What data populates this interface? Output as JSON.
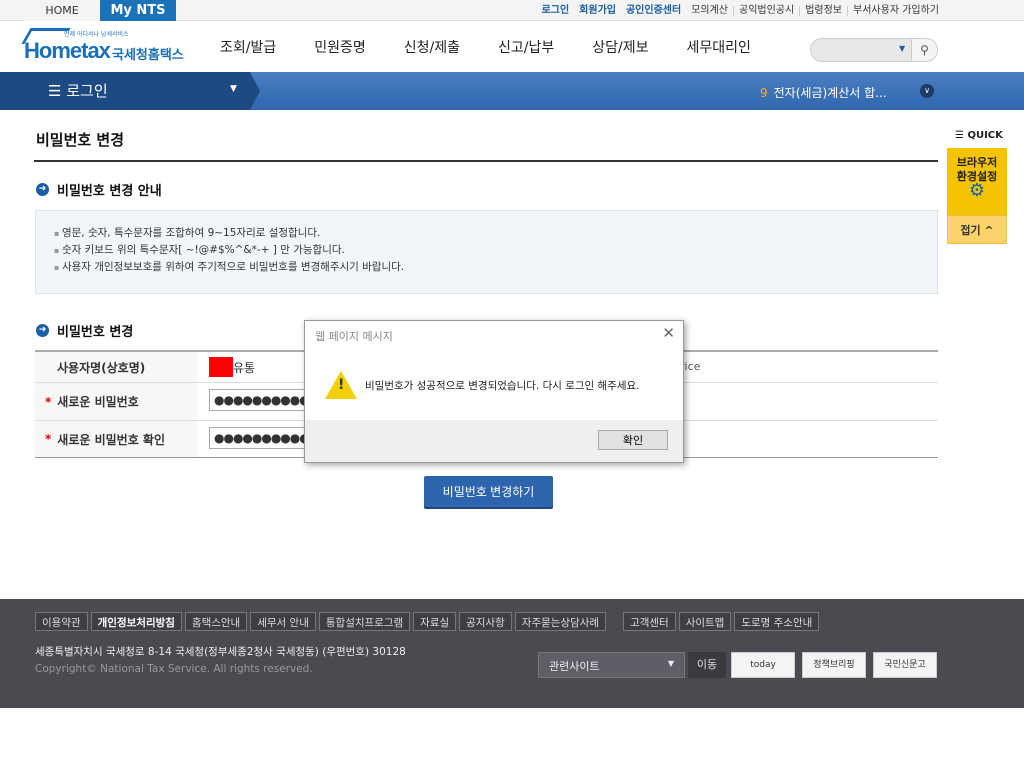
{
  "topbar": {
    "home": "HOME",
    "mynts": "My NTS",
    "links_primary": [
      "로그인",
      "회원가입",
      "공인인증센터"
    ],
    "links_secondary": [
      "모의계산",
      "공익법인공시",
      "법령정보",
      "부서사용자 가입하기"
    ]
  },
  "header": {
    "logo_text": "Hometax",
    "logo_kor": "국세청홈택스",
    "logo_tagline": "언제 어디서나 납세서비스",
    "nav": [
      "조회/발급",
      "민원증명",
      "신청/제출",
      "신고/납부",
      "상담/제보",
      "세무대리인"
    ],
    "search_placeholder": ""
  },
  "bluebar": {
    "menu": "로그인",
    "notice_num": "9",
    "notice": "전자(세금)계산서 합..."
  },
  "page": {
    "title": "비밀번호 변경",
    "guide_title": "비밀번호 변경 안내",
    "guide": [
      "영문, 숫자, 특수문자를 조합하여 9~15자리로 설정합니다.",
      "숫자 키보드 위의 특수문자[ ~!@#$%^&*-+ ] 만 가능합니다.",
      "사용자 개인정보보호를 위하여 주기적으로 비밀번호를 변경해주시기 바랍니다."
    ],
    "form_title": "비밀번호 변경",
    "fields": [
      {
        "label": "사용자명(상호명)",
        "value": "유통"
      },
      {
        "label": "새로운 비밀번호",
        "value": "●●●●●●●●●●●"
      },
      {
        "label": "새로운 비밀번호 확인",
        "value": "●●●●●●●●●●●"
      }
    ],
    "hidden_text": "rice",
    "submit": "비밀번호 변경하기"
  },
  "quick": {
    "title": "QUICK",
    "browser": "브라우저 환경설정",
    "fold": "접기 ^"
  },
  "footer": {
    "links": [
      "이용약관",
      "개인정보처리방침",
      "홈택스안내",
      "세무서 안내",
      "통합설치프로그램",
      "자료실",
      "공지사항",
      "자주묻는상담사례",
      "고객센터",
      "사이트맵",
      "도로명 주소안내"
    ],
    "address": "세종특별자치시 국세청로 8-14 국세청(정부세종2청사 국세청동) (우편번호) 30128",
    "copyright": "Copyright© National Tax Service. All rights reserved.",
    "related": "관련사이트",
    "go": "이동",
    "banners": [
      "today",
      "정책브리핑",
      "국민신문고"
    ]
  },
  "dialog": {
    "title": "웹 페이지 메시지",
    "message": "비밀번호가 성공적으로 변경되었습니다. 다시 로그인 해주세요.",
    "ok": "확인"
  }
}
